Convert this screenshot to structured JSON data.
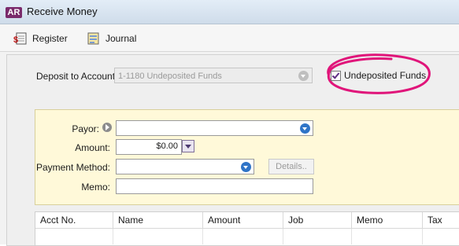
{
  "window": {
    "title": "Receive Money",
    "app_badge": "AR"
  },
  "toolbar": {
    "register_label": "Register",
    "journal_label": "Journal"
  },
  "deposit": {
    "label": "Deposit to Account:",
    "value": "1-1180 Undeposited Funds",
    "undeposited_label": "Undeposited Funds",
    "undeposited_checked": true
  },
  "form": {
    "payor_label": "Payor:",
    "payor_value": "",
    "amount_label": "Amount:",
    "amount_value": "$0.00",
    "payment_method_label": "Payment Method:",
    "payment_method_value": "",
    "details_label": "Details..",
    "memo_label": "Memo:",
    "memo_value": ""
  },
  "grid": {
    "columns": [
      "Acct No.",
      "Name",
      "Amount",
      "Job",
      "Memo",
      "Tax"
    ]
  },
  "colors": {
    "highlight": "#e0157a",
    "accent": "#2f74c7",
    "form_bg": "#fff9d9"
  }
}
